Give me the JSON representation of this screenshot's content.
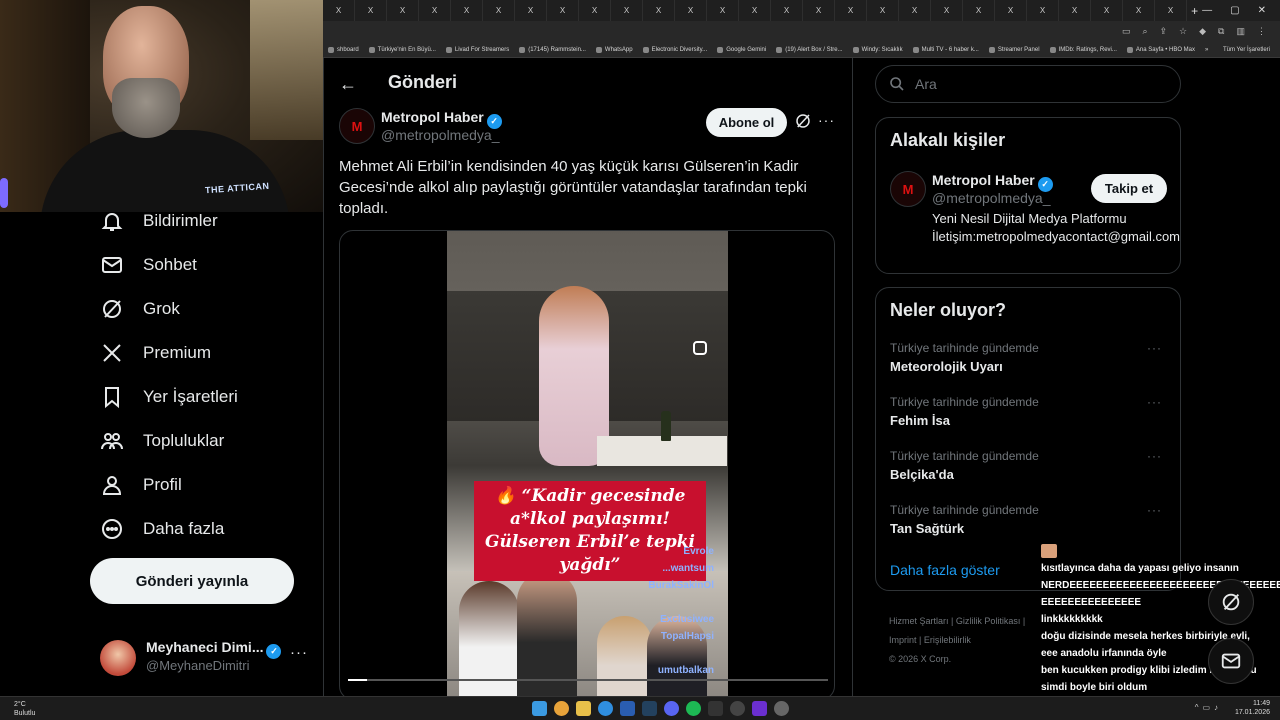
{
  "browser": {
    "tab_labels": [
      "X",
      "X",
      "X",
      "X",
      "X",
      "X",
      "X",
      "X",
      "X",
      "X",
      "X",
      "X",
      "X",
      "X",
      "X",
      "X",
      "X",
      "X",
      "X",
      "X",
      "X",
      "X",
      "X",
      "X",
      "X",
      "X",
      "X"
    ],
    "new_tab": "+",
    "bookmarks": [
      "shboard",
      "Türkiye'nin En Büyü...",
      "Livad For Streamers",
      "(17145) Rammstein...",
      "WhatsApp",
      "Electronic Diversity...",
      "Google Gemini",
      "(19) Alert Box / Stre...",
      "Windy: Sıcaklık",
      "Multi TV - 6 haber k...",
      "Streamer Panel",
      "IMDb: Ratings, Revi...",
      "Ana Sayfa • HBO Max"
    ],
    "bookmarks_more": "»",
    "all_bookmarks": "Tüm Yer İşaretleri"
  },
  "nav": {
    "items": [
      {
        "label": "Bildirimler",
        "icon": "bell-icon"
      },
      {
        "label": "Sohbet",
        "icon": "mail-icon"
      },
      {
        "label": "Grok",
        "icon": "grok-icon"
      },
      {
        "label": "Premium",
        "icon": "x-logo-icon"
      },
      {
        "label": "Yer İşaretleri",
        "icon": "bookmark-icon"
      },
      {
        "label": "Topluluklar",
        "icon": "communities-icon"
      },
      {
        "label": "Profil",
        "icon": "profile-icon"
      },
      {
        "label": "Daha fazla",
        "icon": "more-circle-icon"
      }
    ],
    "post_button": "Gönderi yayınla",
    "profile": {
      "name": "Meyhaneci Dimi...",
      "handle": "@MeyhaneDimitri",
      "more": "···"
    }
  },
  "post": {
    "back": "←",
    "page_title": "Gönderi",
    "author": "Metropol Haber",
    "handle": "@metropolmedya_",
    "avatar_letter": "M",
    "subscribe": "Abone ol",
    "more": "···",
    "text": "Mehmet Ali Erbil’in kendisinden 40 yaş küçük karısı Gülseren’in Kadir Gecesi’nde alkol alıp paylaştığı görüntüler vatandaşlar tarafından tepki topladı.",
    "video_caption": "🔥 “Kadir gecesinde a*lkol paylaşımı! Gülseren Erbil’e tepki yağdı”",
    "video_progress": 0.04
  },
  "search": {
    "placeholder": "Ara"
  },
  "related": {
    "title": "Alakalı kişiler",
    "name": "Metropol Haber",
    "handle": "@metropolmedya_",
    "follow": "Takip et",
    "bio": "Yeni Nesil Dijital Medya Platformu İletişim:metropolmedyacontact@gmail.com"
  },
  "trends": {
    "title": "Neler oluyor?",
    "items": [
      {
        "category": "Türkiye tarihinde gündemde",
        "topic": "Meteorolojik Uyarı"
      },
      {
        "category": "Türkiye tarihinde gündemde",
        "topic": "Fehim İsa"
      },
      {
        "category": "Türkiye tarihinde gündemde",
        "topic": "Belçika'da"
      },
      {
        "category": "Türkiye tarihinde gündemde",
        "topic": "Tan Sağtürk"
      }
    ],
    "show_more": "Daha fazla göster"
  },
  "footer": {
    "line1": "Hizmet Şartları  |  Gizlilik Politikası  |",
    "line2": "Imprint  |  Erişilebilirlik",
    "copyright": "© 2026 X Corp."
  },
  "chat": [
    {
      "user": "Evrole",
      "text": ""
    },
    {
      "user": "...wantsum",
      "text": "kısıtlayınca daha da yapası geliyo insanın"
    },
    {
      "user": "BurakSakinOl",
      "text": "NERDEEEEEEEEEEEEEEEEEEEEEEEEEEEEEEEE"
    },
    {
      "user": "",
      "text": "EEEEEEEEEEEEEEE"
    },
    {
      "user": "Exclusiwee",
      "text": "linkkkkkkkkk"
    },
    {
      "user": "TopalHapsi",
      "text": "doğu dizisinde mesela herkes birbiriyle evli,"
    },
    {
      "user": "",
      "text": "eee anadolu irfanında öyle"
    },
    {
      "user": "umutbalkan",
      "text": "ben kucukken prodigy klibi izledim rakı yoktu"
    },
    {
      "user": "",
      "text": "simdi boyle biri oldum"
    }
  ],
  "taskbar": {
    "weather_temp": "2°C",
    "weather_desc": "Bulutlu",
    "time": "11:49",
    "date": "17.01.2026"
  },
  "colors": {
    "accent": "#1d9bf0",
    "border": "#2f3336",
    "muted": "#71767b",
    "caption_red": "#c8102e"
  }
}
